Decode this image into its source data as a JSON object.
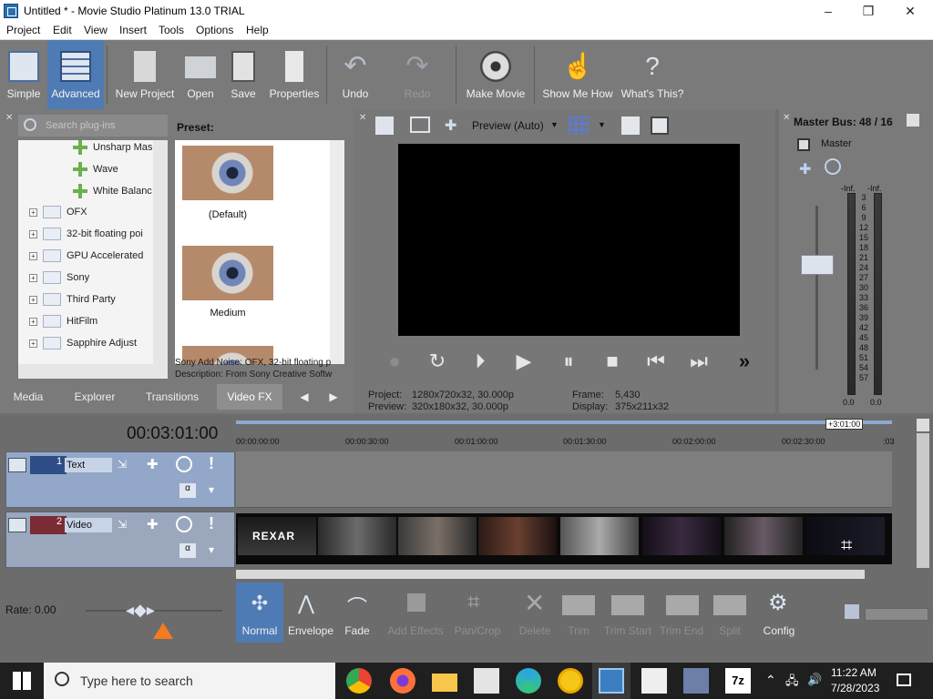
{
  "window": {
    "title": "Untitled * - Movie Studio Platinum 13.0 TRIAL",
    "min": "–",
    "max": "❐",
    "close": "✕"
  },
  "menu": [
    "Project",
    "Edit",
    "View",
    "Insert",
    "Tools",
    "Options",
    "Help"
  ],
  "toolbar": {
    "simple": "Simple",
    "advanced": "Advanced",
    "new_project": "New Project",
    "open": "Open",
    "save": "Save",
    "properties": "Properties",
    "undo": "Undo",
    "redo": "Redo",
    "make_movie": "Make Movie",
    "show_me_how": "Show Me How",
    "whats_this": "What's This?"
  },
  "plugins": {
    "search_placeholder": "Search plug-ins",
    "preset_label": "Preset:",
    "tree": [
      "Unsharp Mas",
      "Wave",
      "White Balanc",
      "OFX",
      "32-bit floating poi",
      "GPU Accelerated",
      "Sony",
      "Third Party",
      "HitFilm",
      "Sapphire Adjust"
    ],
    "presets": [
      "(Default)",
      "Medium"
    ],
    "description_1": "Sony Add Noise: OFX, 32-bit floating p",
    "description_2": "Description: From Sony Creative Softw",
    "tabs": [
      "Media",
      "Explorer",
      "Transitions",
      "Video FX"
    ]
  },
  "preview": {
    "mode": "Preview (Auto)",
    "project_label": "Project:",
    "project_value": "1280x720x32, 30.000p",
    "preview_label": "Preview:",
    "preview_value": "320x180x32, 30.000p",
    "frame_label": "Frame:",
    "frame_value": "5,430",
    "display_label": "Display:",
    "display_value": "375x211x32"
  },
  "master": {
    "title": "Master Bus: 48 / 16",
    "label": "Master",
    "inf_l": "-Inf.",
    "inf_r": "-Inf.",
    "scale": [
      "3",
      "6",
      "9",
      "12",
      "15",
      "18",
      "21",
      "24",
      "27",
      "30",
      "33",
      "36",
      "39",
      "42",
      "45",
      "48",
      "51",
      "54",
      "57"
    ],
    "bottom_l": "0.0",
    "bottom_r": "0.0"
  },
  "timeline": {
    "time": "00:03:01:00",
    "end_marker": "+3:01:00",
    "ruler": [
      "00:00:00:00",
      "00:00:30:00",
      "00:01:00:00",
      "00:01:30:00",
      "00:02:00:00",
      "00:02:30:00",
      ":03"
    ],
    "tracks": [
      {
        "num": "1",
        "name": "Text"
      },
      {
        "num": "2",
        "name": "Video"
      }
    ],
    "rate": "Rate: 0.00",
    "clip_title": "REXAR"
  },
  "tools": [
    "Normal",
    "Envelope",
    "Fade",
    "Add Effects",
    "Pan/Crop",
    "Delete",
    "Trim",
    "Trim Start",
    "Trim End",
    "Split",
    "Config"
  ],
  "taskbar": {
    "search": "Type here to search",
    "time": "11:22 AM",
    "date": "7/28/2023",
    "zip": "7z"
  }
}
